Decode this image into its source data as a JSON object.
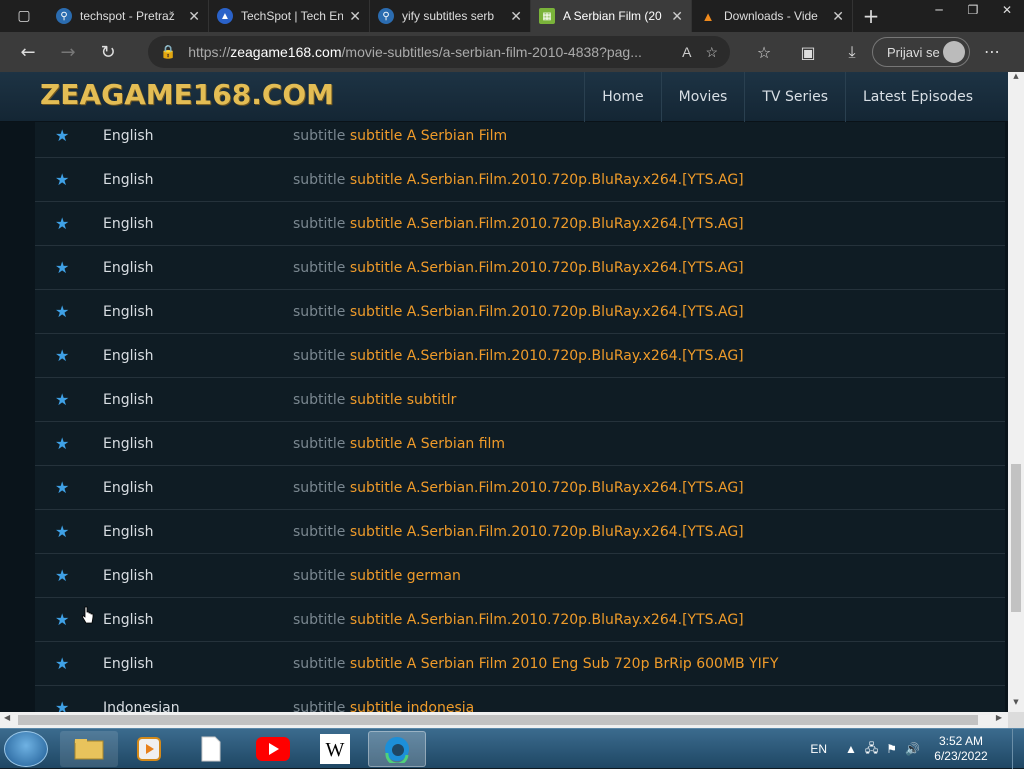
{
  "browser": {
    "tabs": [
      {
        "title": "techspot - Pretraž",
        "active": false,
        "icon": "search-icon"
      },
      {
        "title": "TechSpot | Tech En",
        "active": false,
        "icon": "techspot-icon"
      },
      {
        "title": "yify subtitles serb",
        "active": false,
        "icon": "search-icon"
      },
      {
        "title": "A Serbian Film (20",
        "active": true,
        "icon": "site-icon"
      },
      {
        "title": "Downloads - Vide",
        "active": false,
        "icon": "vlc-icon"
      }
    ],
    "url_prefix": "https://",
    "url_domain": "zeagame168.com",
    "url_path": "/movie-subtitles/a-serbian-film-2010-4838?pag...",
    "signin_label": "Prijavi se"
  },
  "site": {
    "logo": "ZEAGAME168.COM",
    "nav": [
      "Home",
      "Movies",
      "TV Series",
      "Latest Episodes"
    ]
  },
  "subtitles": [
    {
      "lang": "English",
      "prefix": "subtitle",
      "link": "subtitle A Serbian Film"
    },
    {
      "lang": "English",
      "prefix": "subtitle",
      "link": "subtitle A.Serbian.Film.2010.720p.BluRay.x264.[YTS.AG]"
    },
    {
      "lang": "English",
      "prefix": "subtitle",
      "link": "subtitle A.Serbian.Film.2010.720p.BluRay.x264.[YTS.AG]"
    },
    {
      "lang": "English",
      "prefix": "subtitle",
      "link": "subtitle A.Serbian.Film.2010.720p.BluRay.x264.[YTS.AG]"
    },
    {
      "lang": "English",
      "prefix": "subtitle",
      "link": "subtitle A.Serbian.Film.2010.720p.BluRay.x264.[YTS.AG]"
    },
    {
      "lang": "English",
      "prefix": "subtitle",
      "link": "subtitle A.Serbian.Film.2010.720p.BluRay.x264.[YTS.AG]"
    },
    {
      "lang": "English",
      "prefix": "subtitle",
      "link": "subtitle subtitlr"
    },
    {
      "lang": "English",
      "prefix": "subtitle",
      "link": "subtitle A Serbian film"
    },
    {
      "lang": "English",
      "prefix": "subtitle",
      "link": "subtitle A.Serbian.Film.2010.720p.BluRay.x264.[YTS.AG]"
    },
    {
      "lang": "English",
      "prefix": "subtitle",
      "link": "subtitle A.Serbian.Film.2010.720p.BluRay.x264.[YTS.AG]"
    },
    {
      "lang": "English",
      "prefix": "subtitle",
      "link": "subtitle german"
    },
    {
      "lang": "English",
      "prefix": "subtitle",
      "link": "subtitle A.Serbian.Film.2010.720p.BluRay.x264.[YTS.AG]"
    },
    {
      "lang": "English",
      "prefix": "subtitle",
      "link": "subtitle A Serbian Film 2010 Eng Sub 720p BrRip 600MB YIFY"
    },
    {
      "lang": "Indonesian",
      "prefix": "subtitle",
      "link": "subtitle indonesia"
    }
  ],
  "taskbar": {
    "language": "EN",
    "time": "3:52 AM",
    "date": "6/23/2022"
  },
  "colors": {
    "link": "#ef9b2a",
    "star": "#3fa1e6",
    "logo": "#e3bd54"
  }
}
